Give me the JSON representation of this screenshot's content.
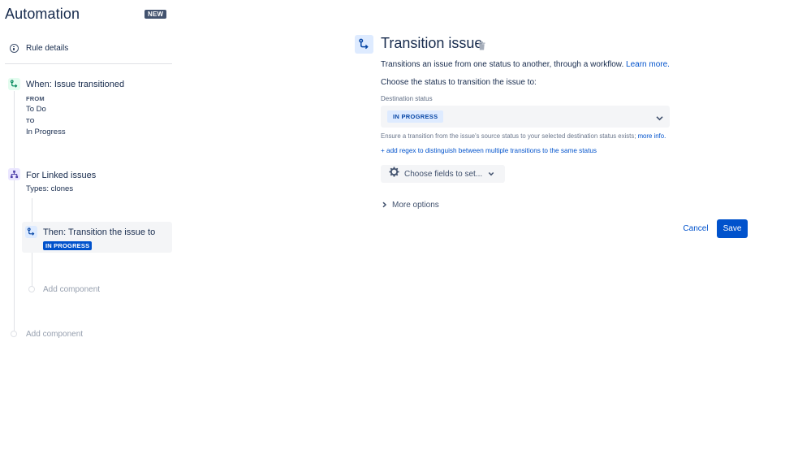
{
  "app": {
    "title": "Automation",
    "badge": "NEW"
  },
  "sidebar": {
    "rule_details_label": "Rule details",
    "trigger": {
      "title": "When: Issue transitioned",
      "from_label": "FROM",
      "from_value": "To Do",
      "to_label": "TO",
      "to_value": "In Progress"
    },
    "branch": {
      "title": "For Linked issues",
      "subtitle": "Types: clones"
    },
    "action": {
      "title": "Then: Transition the issue to",
      "status": "IN PROGRESS"
    },
    "add_component_inner": "Add component",
    "add_component_outer": "Add component"
  },
  "panel": {
    "title": "Transition issue",
    "description": "Transitions an issue from one status to another, through a workflow.",
    "learn_more": "Learn more.",
    "choose_text": "Choose the status to transition the issue to:",
    "destination_label": "Destination status",
    "destination_value": "IN PROGRESS",
    "hint": "Ensure a transition from the issue's source status to your selected destination status exists;",
    "hint_link": "more info.",
    "regex_link": "+ add regex to distinguish between multiple transitions to the same status",
    "choose_fields_label": "Choose fields to set...",
    "more_options_label": "More options",
    "cancel_label": "Cancel",
    "save_label": "Save"
  },
  "colors": {
    "primary": "#0052cc",
    "text": "#172b4d",
    "subtle": "#97a0af",
    "chip_bg": "#deebff",
    "trigger_icon": "#00875a",
    "branch_icon": "#5243aa"
  },
  "icons": {
    "info": "info-icon",
    "trigger": "transition-icon",
    "branch": "hierarchy-icon",
    "action": "transition-icon",
    "trash": "trash-icon",
    "chevron": "chevron-down-icon",
    "gear": "gear-icon",
    "expand": "chevron-right-icon"
  }
}
